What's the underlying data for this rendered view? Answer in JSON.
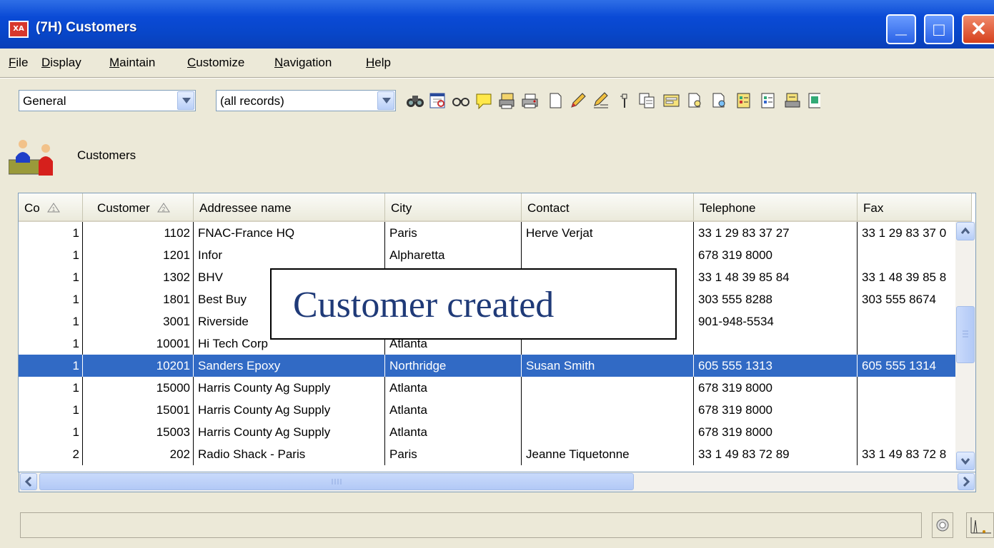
{
  "window": {
    "title": "(7H) Customers",
    "icon_text": "XA"
  },
  "menu": [
    {
      "label": "File",
      "u": "F"
    },
    {
      "label": "Display",
      "u": "D"
    },
    {
      "label": "Maintain",
      "u": "M"
    },
    {
      "label": "Customize",
      "u": "C"
    },
    {
      "label": "Navigation",
      "u": "N"
    },
    {
      "label": "Help",
      "u": "H"
    }
  ],
  "toolbar": {
    "view_value": "General",
    "filter_value": "(all records)"
  },
  "section": {
    "label": "Customers"
  },
  "grid": {
    "columns": [
      "Co",
      "Customer",
      "Addressee name",
      "City",
      "Contact",
      "Telephone",
      "Fax"
    ],
    "sort_marks": {
      "co": "1",
      "customer": "2"
    },
    "rows": [
      {
        "co": "1",
        "customer": "1102",
        "name": "FNAC-France HQ",
        "city": "Paris",
        "contact": "Herve Verjat",
        "tel": "33 1 29 83 37 27",
        "fax": "33 1 29 83 37 0"
      },
      {
        "co": "1",
        "customer": "1201",
        "name": "Infor",
        "city": "Alpharetta",
        "contact": "",
        "tel": "678 319 8000",
        "fax": ""
      },
      {
        "co": "1",
        "customer": "1302",
        "name": "BHV",
        "city": "",
        "contact": "",
        "tel": "33 1 48 39 85 84",
        "fax": "33 1 48 39 85 8"
      },
      {
        "co": "1",
        "customer": "1801",
        "name": "Best Buy",
        "city": "",
        "contact": "",
        "tel": "303 555 8288",
        "fax": "303 555 8674"
      },
      {
        "co": "1",
        "customer": "3001",
        "name": "Riverside",
        "city": "",
        "contact": "",
        "tel": "901-948-5534",
        "fax": ""
      },
      {
        "co": "1",
        "customer": "10001",
        "name": "Hi Tech Corp",
        "city": "Atlanta",
        "contact": "",
        "tel": "",
        "fax": ""
      },
      {
        "co": "1",
        "customer": "10201",
        "name": "Sanders Epoxy",
        "city": "Northridge",
        "contact": "Susan Smith",
        "tel": "605 555 1313",
        "fax": "605 555 1314",
        "selected": true
      },
      {
        "co": "1",
        "customer": "15000",
        "name": "Harris County Ag Supply",
        "city": "Atlanta",
        "contact": "",
        "tel": "678 319 8000",
        "fax": ""
      },
      {
        "co": "1",
        "customer": "15001",
        "name": "Harris County Ag Supply",
        "city": "Atlanta",
        "contact": "",
        "tel": "678 319 8000",
        "fax": ""
      },
      {
        "co": "1",
        "customer": "15003",
        "name": "Harris County Ag Supply",
        "city": "Atlanta",
        "contact": "",
        "tel": "678 319 8000",
        "fax": ""
      },
      {
        "co": "2",
        "customer": "202",
        "name": "Radio Shack - Paris",
        "city": "Paris",
        "contact": "Jeanne Tiquetonne",
        "tel": "33 1 49 83 72 89",
        "fax": "33 1 49 83 72 8"
      }
    ]
  },
  "overlay": {
    "message": "Customer created"
  },
  "colors": {
    "title_bar": "#0a4ad6",
    "selection": "#316ac5",
    "overlay_text": "#1f3a78"
  },
  "icons": [
    "binoculars-icon",
    "browse-icon",
    "glasses-icon",
    "note-icon",
    "print-stack-icon",
    "printer-icon",
    "new-doc-icon",
    "pencil-icon",
    "edit-pencil-icon",
    "tool-icon",
    "copy-icon",
    "form-icon",
    "doc-search-icon",
    "doc-search2-icon",
    "report-icon",
    "report2-icon",
    "report3-icon",
    "report4-icon"
  ]
}
